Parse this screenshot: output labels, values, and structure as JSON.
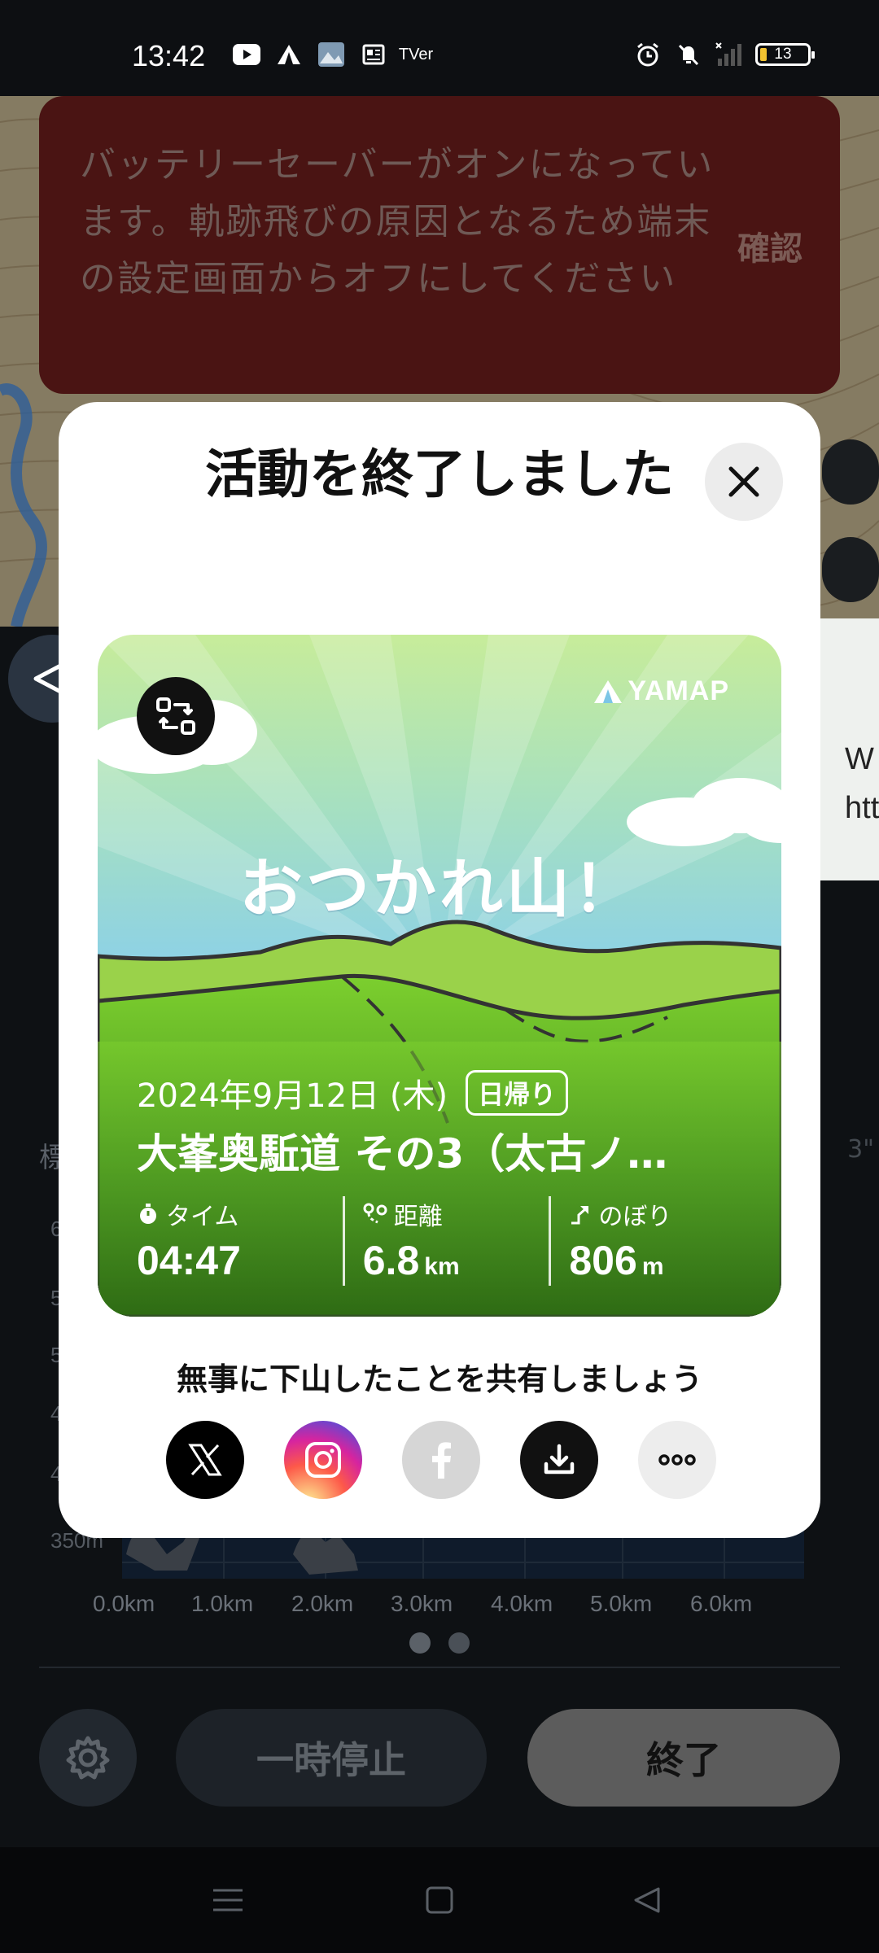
{
  "status_bar": {
    "time": "13:42",
    "left_icons": [
      "youtube-icon",
      "yamap-icon",
      "photo-icon",
      "news-icon",
      "tver-icon"
    ],
    "tver_label": "TVer",
    "battery_level": "13",
    "right_icons": [
      "alarm-icon",
      "mute-icon",
      "signal-icon",
      "battery-icon"
    ]
  },
  "banner": {
    "message": "バッテリーセーバーがオンになっています。軌跡飛びの原因となるため端末の設定画面からオフにしてください",
    "confirm_label": "確認"
  },
  "modal": {
    "title": "活動を終了しました",
    "card": {
      "brand": "YAMAP",
      "catchphrase": "おつかれ山！",
      "date": "2024年9月12日 (木)",
      "tag": "日帰り",
      "activity_name": "大峯奥駈道 その3（太古ノ…",
      "stats": [
        {
          "icon": "stopwatch-icon",
          "label": "タイム",
          "value": "04:47",
          "unit": ""
        },
        {
          "icon": "route-icon",
          "label": "距離",
          "value": "6.8",
          "unit": "km"
        },
        {
          "icon": "ascent-icon",
          "label": "のぼり",
          "value": "806",
          "unit": "m"
        }
      ]
    },
    "share_prompt": "無事に下山したことを共有しましょう",
    "share_buttons": [
      "x-icon",
      "instagram-icon",
      "facebook-icon",
      "download-icon",
      "more-icon"
    ]
  },
  "peek_card": {
    "line1": "W",
    "line2": "htt"
  },
  "background": {
    "elevation_title": "標",
    "right_fragment": "3\"",
    "y_ticks": [
      "6",
      "5",
      "5",
      "4",
      "4",
      "350m"
    ],
    "x_ticks": [
      "0.0km",
      "1.0km",
      "2.0km",
      "3.0km",
      "4.0km",
      "5.0km",
      "6.0km"
    ]
  },
  "controls": {
    "pause_label": "一時停止",
    "end_label": "終了"
  },
  "colors": {
    "banner_bg": "#4a1413",
    "end_button": "#5c5c5c",
    "card_sky": "#8fd4f0",
    "card_grass": "#5fae2a"
  }
}
